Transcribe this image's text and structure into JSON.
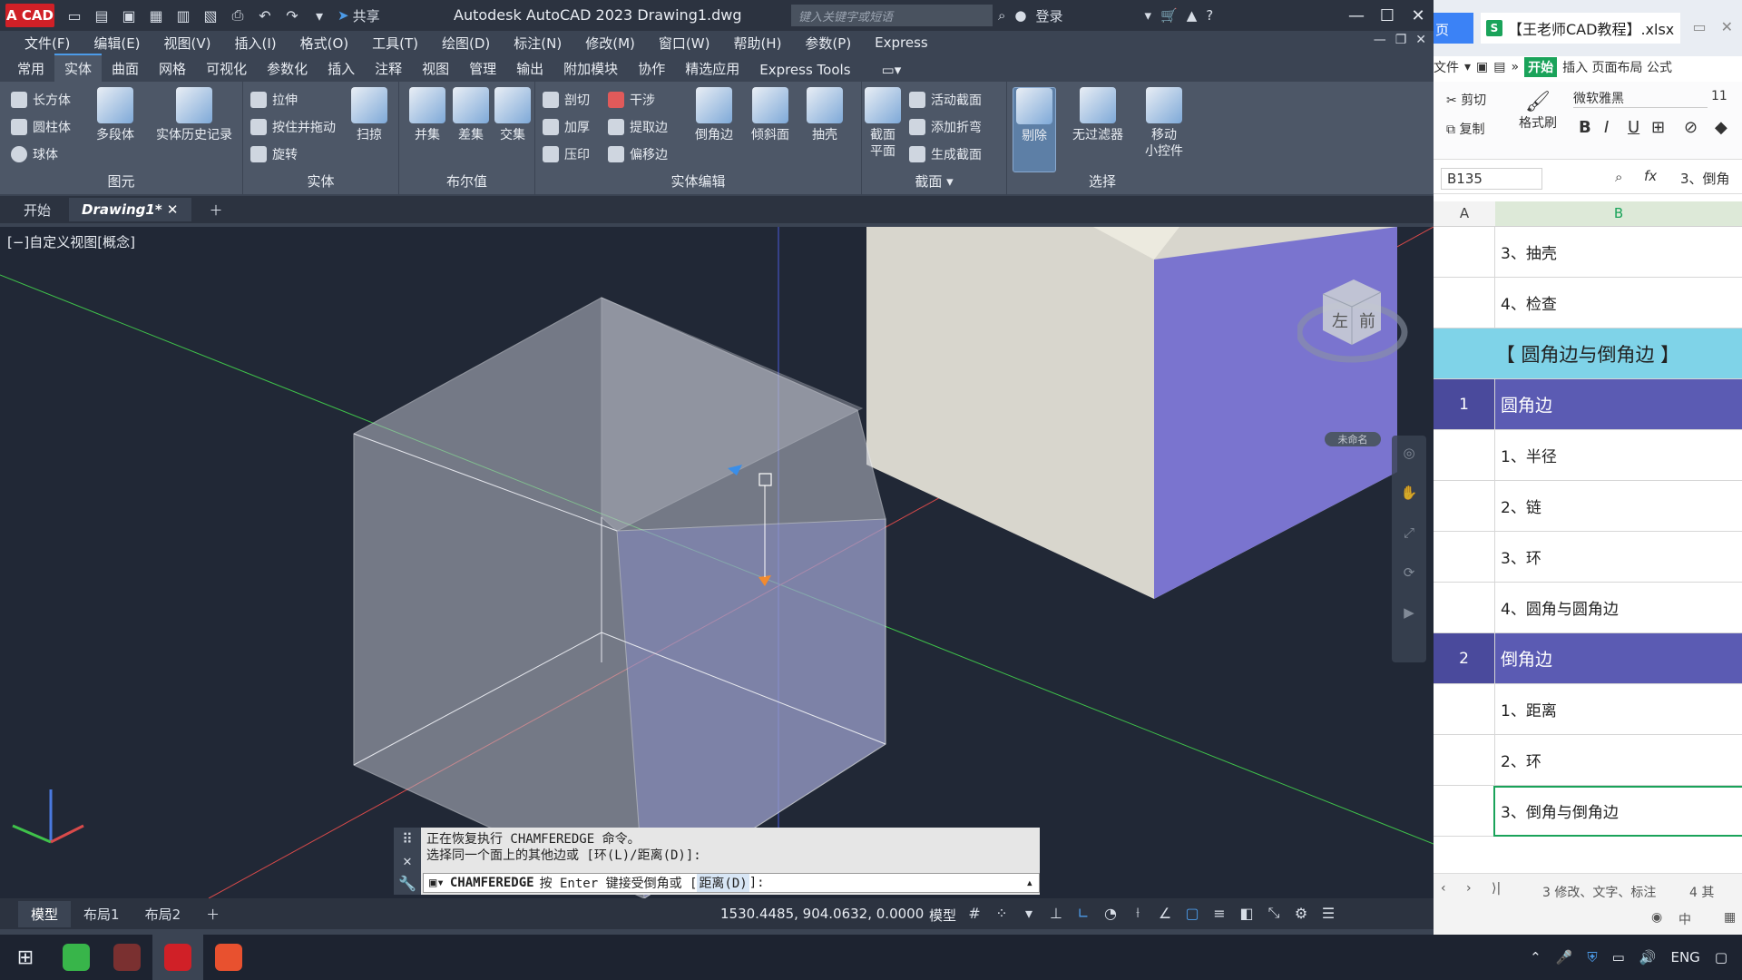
{
  "acad": {
    "logo_text": "A CAD",
    "share_label": "共享",
    "title": "Autodesk AutoCAD 2023   Drawing1.dwg",
    "search_placeholder": "键入关键字或短语",
    "login_label": "登录",
    "menu": [
      "文件(F)",
      "编辑(E)",
      "视图(V)",
      "插入(I)",
      "格式(O)",
      "工具(T)",
      "绘图(D)",
      "标注(N)",
      "修改(M)",
      "窗口(W)",
      "帮助(H)",
      "参数(P)",
      "Express"
    ],
    "ribbon_tabs": [
      "常用",
      "实体",
      "曲面",
      "网格",
      "可视化",
      "参数化",
      "插入",
      "注释",
      "视图",
      "管理",
      "输出",
      "附加模块",
      "协作",
      "精选应用",
      "Express Tools"
    ],
    "active_ribbon_tab": "实体",
    "panels": {
      "primitive": {
        "label": "图元",
        "box": "长方体",
        "cylinder": "圆柱体",
        "sphere": "球体",
        "polysolid": "多段体",
        "history": "实体历史记录"
      },
      "solid": {
        "label": "实体",
        "extrude": "拉伸",
        "presspull": "按住并拖动",
        "revolve": "旋转",
        "sweep": "扫掠"
      },
      "boolean": {
        "label": "布尔值",
        "union": "并集",
        "subtract": "差集",
        "intersect": "交集"
      },
      "solid_edit": {
        "label": "实体编辑",
        "slice": "剖切",
        "interfere": "干涉",
        "thicken": "加厚",
        "extract_edges": "提取边",
        "imprint": "压印",
        "offset_edge": "偏移边",
        "chamfer_edge": "倒角边",
        "taper": "倾斜面",
        "shell": "抽壳"
      },
      "section": {
        "label": "截面",
        "section_plane_1": "截面",
        "section_plane_2": "平面",
        "live_section": "活动截面",
        "add_jog": "添加折弯",
        "generate_section": "生成截面"
      },
      "selection": {
        "label": "选择",
        "cull": "剔除",
        "no_filter": "无过滤器",
        "gizmo_1": "移动",
        "gizmo_2": "小控件"
      }
    },
    "doc_tabs": {
      "start": "开始",
      "drawing": "Drawing1*"
    },
    "view_label": "[−]自定义视图[概念]",
    "viewcube": {
      "left_face": "左",
      "front_face": "前",
      "unnamed": "未命名"
    },
    "command": {
      "history_1": "正在恢复执行 CHAMFEREDGE 命令。",
      "history_2": "选择同一个面上的其他边或 [环(L)/距离(D)]:",
      "prompt_cmd": "CHAMFEREDGE",
      "prompt_text": "按 Enter 键接受倒角或 [",
      "prompt_option": "距离(D)",
      "prompt_end": "]:"
    },
    "layout_tabs": [
      "模型",
      "布局1",
      "布局2"
    ],
    "coords": "1530.4485, 904.0632, 0.0000",
    "model_label": "模型"
  },
  "excel": {
    "left_tab": "页",
    "file_name": "【王老师CAD教程】.xlsx",
    "menu_file": "文件",
    "menu_start": "开始",
    "menu_rest": "插入 页面布局 公式",
    "cut": "剪切",
    "copy": "复制",
    "format_painter": "格式刷",
    "font_name": "微软雅黑",
    "font_size": "11",
    "name_box": "B135",
    "formula_value": "3、倒角",
    "col_a": "A",
    "col_b": "B",
    "rows": [
      {
        "num": "",
        "text": "3、抽壳",
        "style": "plain"
      },
      {
        "num": "",
        "text": "4、检查",
        "style": "plain"
      },
      {
        "num": "",
        "text": "【 圆角边与倒角边 】",
        "style": "header"
      },
      {
        "num": "1",
        "text": "圆角边",
        "style": "section"
      },
      {
        "num": "",
        "text": "1、半径",
        "style": "plain"
      },
      {
        "num": "",
        "text": "2、链",
        "style": "plain"
      },
      {
        "num": "",
        "text": "3、环",
        "style": "plain"
      },
      {
        "num": "",
        "text": "4、圆角与圆角边",
        "style": "plain"
      },
      {
        "num": "2",
        "text": "倒角边",
        "style": "section"
      },
      {
        "num": "",
        "text": "1、距离",
        "style": "plain"
      },
      {
        "num": "",
        "text": "2、环",
        "style": "plain"
      },
      {
        "num": "",
        "text": "3、倒角与倒角边",
        "style": "selected"
      }
    ],
    "sheet_tabs": "3 修改、文字、标注",
    "sheet_tab_2": "4 其"
  },
  "taskbar": {
    "lang": "ENG"
  },
  "colors": {
    "header_bg": "#7fd3e8",
    "section_bg": "#5b5bb3",
    "selected_border": "#1aa35a",
    "accent": "#4c9be8"
  }
}
